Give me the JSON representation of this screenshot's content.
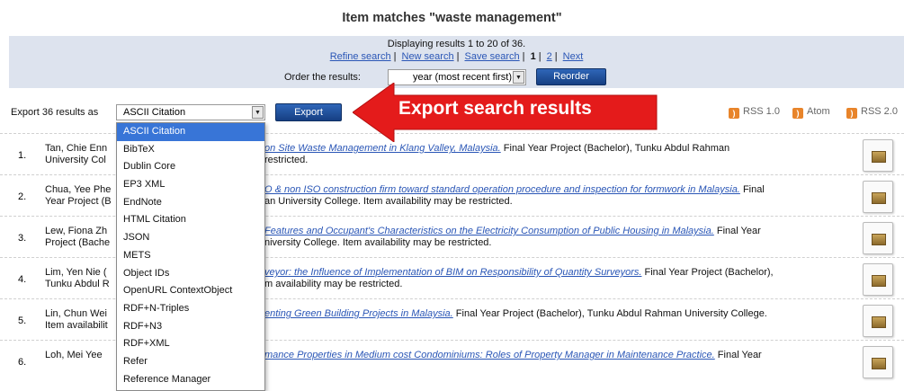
{
  "header": {
    "title": "Item matches \"waste management\""
  },
  "search_panel": {
    "displaying": "Displaying results 1 to 20 of 36.",
    "links": {
      "refine": "Refine search",
      "new": "New search",
      "save": "Save search",
      "page1": "1",
      "page2": "2",
      "next": "Next"
    },
    "order_label": "Order the results:",
    "order_value": "year (most recent first)",
    "reorder_label": "Reorder"
  },
  "export": {
    "label": "Export 36 results as",
    "selected": "ASCII Citation",
    "button_label": "Export",
    "callout": "Export search results",
    "options": [
      "ASCII Citation",
      "BibTeX",
      "Dublin Core",
      "EP3 XML",
      "EndNote",
      "HTML Citation",
      "JSON",
      "METS",
      "Object IDs",
      "OpenURL ContextObject",
      "RDF+N-Triples",
      "RDF+N3",
      "RDF+XML",
      "Refer",
      "Reference Manager"
    ]
  },
  "feeds": {
    "rss1": "RSS 1.0",
    "atom": "Atom",
    "rss2": "RSS 2.0"
  },
  "results": [
    {
      "num": "1.",
      "authors_1": "Tan, Chie Enn",
      "authors_2": "University Col",
      "title": "on Site Waste Management in Klang Valley, Malaysia.",
      "rest_1": "Final Year Project (Bachelor), Tunku Abdul Rahman",
      "line2": "restricted."
    },
    {
      "num": "2.",
      "authors_1": "Chua, Yee Phe",
      "authors_2": "Year Project (B",
      "title": "O & non ISO construction firm toward standard operation procedure and inspection for formwork in Malaysia.",
      "rest_1": "Final",
      "line2": "an University College. Item availability may be restricted."
    },
    {
      "num": "3.",
      "authors_1": "Lew, Fiona Zh",
      "authors_2": "Project (Bache",
      "title": "Features and Occupant's Characteristics on the Electricity Consumption of Public Housing in Malaysia.",
      "rest_1": "Final Year",
      "line2": "niversity College. Item availability may be restricted."
    },
    {
      "num": "4.",
      "authors_1": "Lim, Yen Nie (",
      "authors_2": "Tunku Abdul R",
      "title": "veyor: the Influence of Implementation of BIM on Responsibility of Quantity Surveyors.",
      "rest_1": "Final Year Project (Bachelor),",
      "line2": "m availability may be restricted."
    },
    {
      "num": "5.",
      "authors_1": "Lin, Chun Wei",
      "authors_2": "Item availabilit",
      "title": "enting Green Building Projects in Malaysia.",
      "rest_1": "Final Year Project (Bachelor), Tunku Abdul Rahman University College.",
      "line2": ""
    },
    {
      "num": "6.",
      "authors_1": "Loh, Mei Yee",
      "authors_2": "",
      "title": "mance Properties in Medium cost Condominiums: Roles of Property Manager in Maintenance Practice.",
      "rest_1": "Final Year",
      "line2": ""
    }
  ]
}
